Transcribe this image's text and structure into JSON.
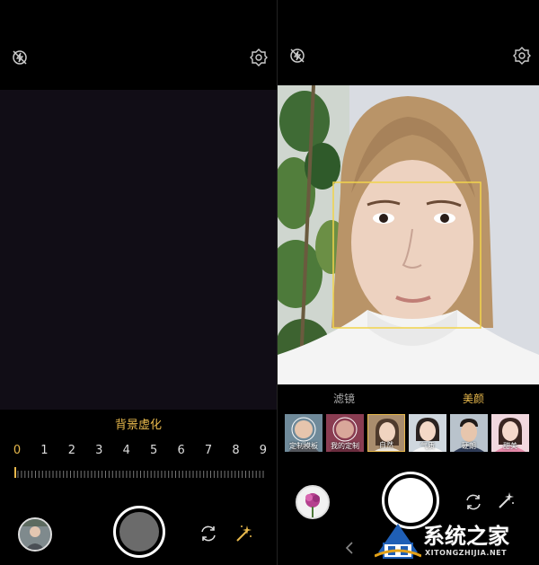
{
  "left": {
    "label": "背景虚化",
    "scale": [
      "0",
      "1",
      "2",
      "3",
      "4",
      "5",
      "6",
      "7",
      "8",
      "9"
    ],
    "active_index": 0
  },
  "right": {
    "tabs": [
      "滤镜",
      "美颜"
    ],
    "active_tab": "美颜",
    "filters": [
      "定制模板",
      "我的定制",
      "自然",
      "气质",
      "硬朗",
      "甜美"
    ]
  },
  "watermark": {
    "title": "系统之家",
    "url": "XITONGZHIJIA.NET"
  },
  "colors": {
    "accent": "#e7b84c",
    "face_box": "#f2d44a"
  }
}
